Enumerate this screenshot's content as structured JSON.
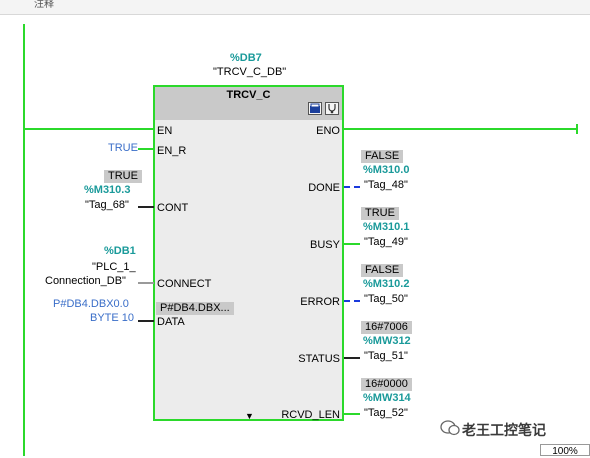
{
  "top_strip": {
    "label": "注释"
  },
  "instance": {
    "db": "%DB7",
    "name": "\"TRCV_C_DB\""
  },
  "block": {
    "title": "TRCV_C"
  },
  "inputs": {
    "en": {
      "pin": "EN"
    },
    "en_r": {
      "pin": "EN_R",
      "value": "TRUE"
    },
    "cont": {
      "pin": "CONT",
      "status": "TRUE",
      "address": "%M310.3",
      "tag": "\"Tag_68\""
    },
    "connect": {
      "pin": "CONNECT",
      "address": "%DB1",
      "tag_line1": "\"PLC_1_",
      "tag_line2": "Connection_DB\""
    },
    "data": {
      "pin": "DATA",
      "pin_value": "P#DB4.DBX...",
      "value_line1": "P#DB4.DBX0.0",
      "value_line2": "BYTE 10"
    }
  },
  "outputs": {
    "eno": {
      "pin": "ENO"
    },
    "done": {
      "pin": "DONE",
      "status": "FALSE",
      "address": "%M310.0",
      "tag": "\"Tag_48\""
    },
    "busy": {
      "pin": "BUSY",
      "status": "TRUE",
      "address": "%M310.1",
      "tag": "\"Tag_49\""
    },
    "error": {
      "pin": "ERROR",
      "status": "FALSE",
      "address": "%M310.2",
      "tag": "\"Tag_50\""
    },
    "status": {
      "pin": "STATUS",
      "status": "16#7006",
      "address": "%MW312",
      "tag": "\"Tag_51\""
    },
    "rcvd_len": {
      "pin": "RCVD_LEN",
      "status": "16#0000",
      "address": "%MW314",
      "tag": "\"Tag_52\""
    }
  },
  "watermark": {
    "text": "老王工控笔记"
  },
  "zoom": {
    "value": "100%"
  },
  "colors": {
    "power_flow": "#2bd92b",
    "address": "#1a9a9a",
    "constant": "#3a6ec8",
    "status_bg": "#c9c9c9"
  }
}
